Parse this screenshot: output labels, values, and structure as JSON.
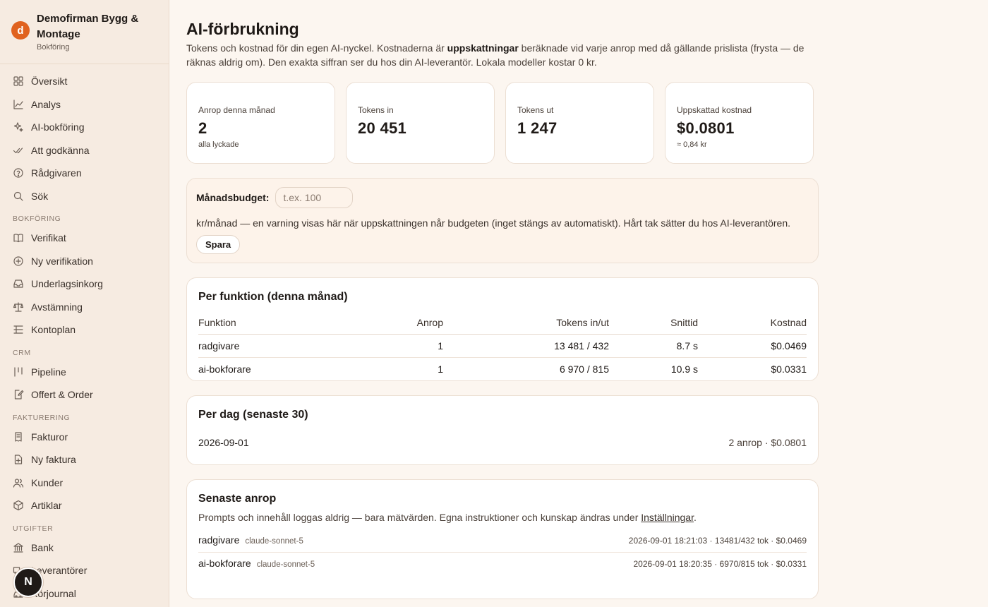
{
  "brand": {
    "logo_letter": "d",
    "name": "Demofirman Bygg & Montage",
    "sub": "Bokföring",
    "accent": "#e0621f"
  },
  "nav": {
    "top": [
      {
        "label": "Översikt",
        "icon": "grid-icon"
      },
      {
        "label": "Analys",
        "icon": "chart-line-icon"
      },
      {
        "label": "AI-bokföring",
        "icon": "sparkle-icon"
      },
      {
        "label": "Att godkänna",
        "icon": "double-check-icon"
      },
      {
        "label": "Rådgivaren",
        "icon": "help-circle-icon"
      },
      {
        "label": "Sök",
        "icon": "search-icon"
      }
    ],
    "sections": [
      {
        "title": "BOKFÖRING",
        "items": [
          {
            "label": "Verifikat",
            "icon": "book-icon"
          },
          {
            "label": "Ny verifikation",
            "icon": "plus-circle-icon"
          },
          {
            "label": "Underlagsinkorg",
            "icon": "inbox-icon"
          },
          {
            "label": "Avstämning",
            "icon": "scale-icon"
          },
          {
            "label": "Kontoplan",
            "icon": "list-icon"
          }
        ]
      },
      {
        "title": "CRM",
        "items": [
          {
            "label": "Pipeline",
            "icon": "pipeline-icon"
          },
          {
            "label": "Offert & Order",
            "icon": "document-edit-icon"
          }
        ]
      },
      {
        "title": "FAKTURERING",
        "items": [
          {
            "label": "Fakturor",
            "icon": "invoice-icon"
          },
          {
            "label": "Ny faktura",
            "icon": "file-plus-icon"
          },
          {
            "label": "Kunder",
            "icon": "users-icon"
          },
          {
            "label": "Artiklar",
            "icon": "package-icon"
          }
        ]
      },
      {
        "title": "UTGIFTER",
        "items": [
          {
            "label": "Bank",
            "icon": "bank-icon"
          },
          {
            "label": "Leverantörer",
            "icon": "truck-icon"
          },
          {
            "label": "Körjournal",
            "icon": "car-icon"
          }
        ]
      }
    ],
    "avatar_letter": "N"
  },
  "page": {
    "title": "AI-förbrukning",
    "desc_before": "Tokens och kostnad för din egen AI-nyckel. Kostnaderna är ",
    "desc_bold": "uppskattningar",
    "desc_after": " beräknade vid varje anrop med då gällande prislista (frysta — de räknas aldrig om). Den exakta siffran ser du hos din AI-leverantör. Lokala modeller kostar 0 kr."
  },
  "stats": [
    {
      "label": "Anrop denna månad",
      "value": "2",
      "sub": "alla lyckade"
    },
    {
      "label": "Tokens in",
      "value": "20 451",
      "sub": ""
    },
    {
      "label": "Tokens ut",
      "value": "1 247",
      "sub": ""
    },
    {
      "label": "Uppskattad kostnad",
      "value": "$0.0801",
      "sub": "≈ 0,84 kr"
    }
  ],
  "budget": {
    "label": "Månadsbudget:",
    "placeholder": "t.ex. 100",
    "note": "kr/månad — en varning visas här när uppskattningen når budgeten (inget stängs av automatiskt). Hårt tak sätter du hos AI-leverantören.",
    "save_label": "Spara"
  },
  "per_function": {
    "title": "Per funktion (denna månad)",
    "columns": [
      "Funktion",
      "Anrop",
      "Tokens in/ut",
      "Snittid",
      "Kostnad"
    ],
    "rows": [
      [
        "radgivare",
        "1",
        "13 481 / 432",
        "8.7 s",
        "$0.0469"
      ],
      [
        "ai-bokforare",
        "1",
        "6 970 / 815",
        "10.9 s",
        "$0.0331"
      ]
    ]
  },
  "per_day": {
    "title": "Per dag (senaste 30)",
    "rows": [
      {
        "date": "2026-09-01",
        "summary": "2 anrop · $0.0801"
      }
    ]
  },
  "recent": {
    "title": "Senaste anrop",
    "desc_before": "Prompts och innehåll loggas aldrig — bara mätvärden. Egna instruktioner och kunskap ändras under ",
    "desc_link": "Inställningar",
    "desc_after": ".",
    "rows": [
      {
        "fn": "radgivare",
        "model": "claude-sonnet-5",
        "meta": "2026-09-01 18:21:03 · 13481/432 tok · $0.0469"
      },
      {
        "fn": "ai-bokforare",
        "model": "claude-sonnet-5",
        "meta": "2026-09-01 18:20:35 · 6970/815 tok · $0.0331"
      }
    ]
  }
}
